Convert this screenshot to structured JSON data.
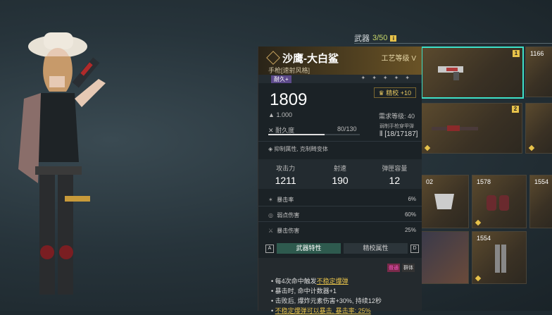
{
  "inventory": {
    "category": "武器",
    "count": "3/50",
    "info_glyph": "i",
    "items": [
      {
        "slot": "1",
        "power": ""
      },
      {
        "slot": "",
        "power": "1166"
      },
      {
        "slot": "2",
        "power": ""
      },
      {
        "slot": "",
        "power": "02"
      },
      {
        "slot": "",
        "power": "1578"
      },
      {
        "slot": "",
        "power": "1554"
      },
      {
        "slot": "",
        "power": "1554"
      }
    ]
  },
  "detail": {
    "name": "沙鹰-大白鲨",
    "subtitle": "手枪[速射风格]",
    "craft_label": "工艺等级",
    "craft_level": "V",
    "tag": "耐久+",
    "power": "1809",
    "refine": "精校 +10",
    "weight": "1.000",
    "requirement": "需求等级: 40",
    "durability_label": "耐久度",
    "durability_value": "80/130",
    "durability_fraction": 0.615,
    "ammo_type": "弱制手枪穿甲弹",
    "ammo_count": "[18/17187]",
    "trait": "抑制属性, 克制畸变体",
    "stats": [
      {
        "label": "攻击力",
        "value": "1211"
      },
      {
        "label": "射速",
        "value": "190"
      },
      {
        "label": "弹匣容量",
        "value": "12"
      }
    ],
    "sub_stats": [
      {
        "label": "暴击率",
        "value": "6%"
      },
      {
        "label": "弱点伤害",
        "value": "60%"
      },
      {
        "label": "暴击伤害",
        "value": "25%"
      }
    ],
    "tabs": {
      "left_key": "A",
      "right_key": "D",
      "tab1": "武器特性",
      "tab2": "精校属性"
    },
    "badges": {
      "b1": "普通",
      "b2": "群体"
    },
    "effects": {
      "line1_pre": "每4次命中触发",
      "line1_link": "不稳定爆弹",
      "line2": "暴击时, 命中计数器+1",
      "line3": "击败后, 爆炸元素伤害+30%, 持续12秒",
      "line4": "不稳定爆弹可以暴击, 暴击率: 25%"
    }
  },
  "colors": {
    "accent": "#3de0c8",
    "gold": "#e7c24a",
    "panel": "#1b2226"
  }
}
